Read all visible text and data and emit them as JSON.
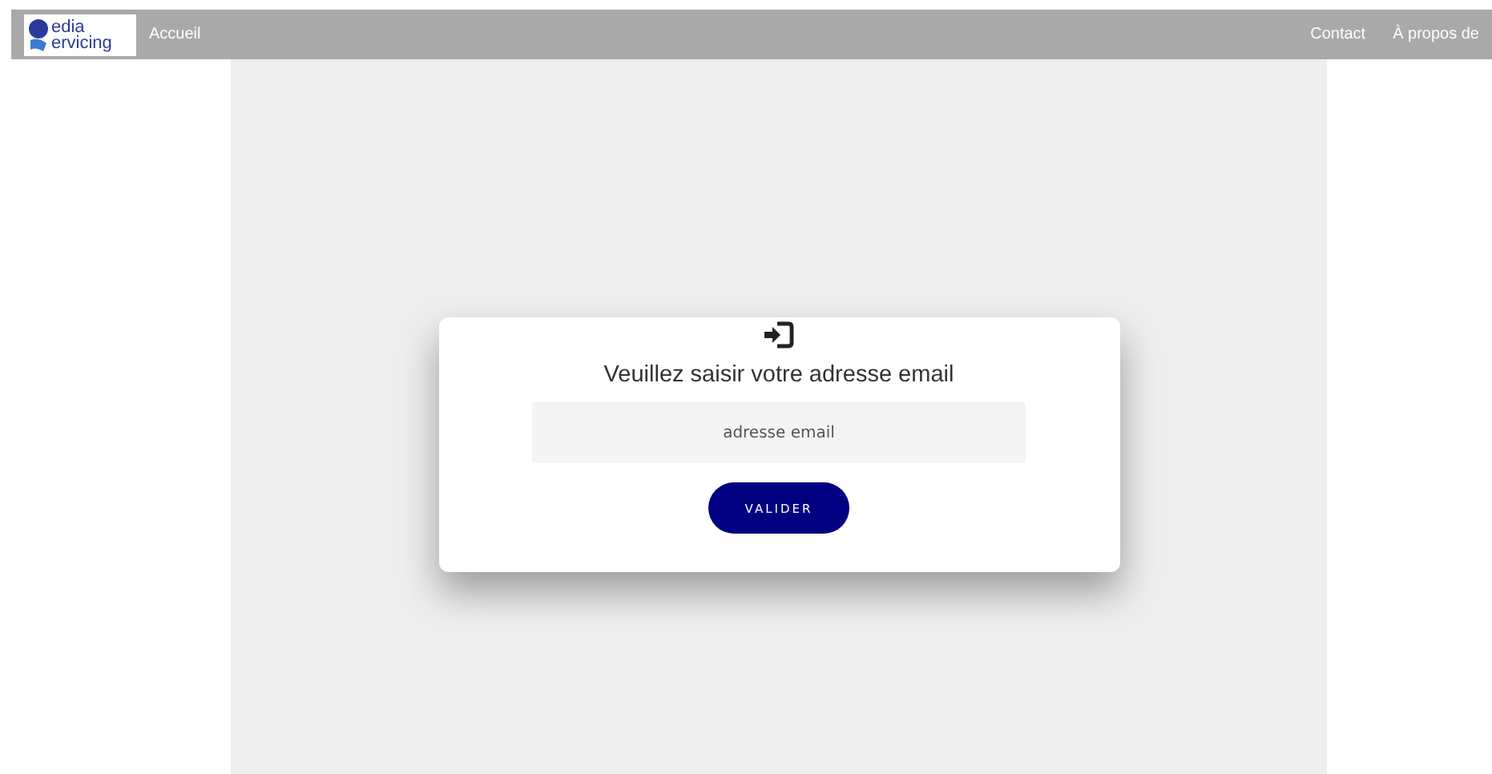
{
  "navbar": {
    "logo": {
      "line_1": "edia",
      "line_2": "ervicing"
    },
    "left_links": [
      "Accueil"
    ],
    "right_links": [
      "Contact",
      "À propos de"
    ]
  },
  "login_card": {
    "title": "Veuillez saisir votre adresse email",
    "email_field": {
      "placeholder": "adresse email"
    },
    "submit_button": "VALIDER"
  }
}
